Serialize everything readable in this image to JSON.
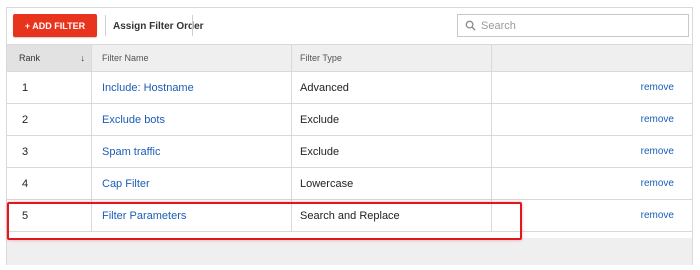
{
  "toolbar": {
    "add_filter_label": "+ ADD FILTER",
    "assign_order_label": "Assign Filter Order",
    "search_placeholder": "Search"
  },
  "table": {
    "columns": {
      "rank": "Rank",
      "sort_indicator": "↓",
      "name": "Filter Name",
      "type": "Filter Type"
    },
    "rows": [
      {
        "rank": "1",
        "name": "Include: Hostname",
        "type": "Advanced",
        "action": "remove"
      },
      {
        "rank": "2",
        "name": "Exclude bots",
        "type": "Exclude",
        "action": "remove"
      },
      {
        "rank": "3",
        "name": "Spam traffic",
        "type": "Exclude",
        "action": "remove"
      },
      {
        "rank": "4",
        "name": "Cap Filter",
        "type": "Lowercase",
        "action": "remove"
      },
      {
        "rank": "5",
        "name": "Filter Parameters",
        "type": "Search and Replace",
        "action": "remove"
      }
    ]
  },
  "colors": {
    "primary_button": "#e8341c",
    "link": "#1a5db5",
    "highlight_box": "#e0171f"
  },
  "icons": {
    "search": "search-icon",
    "sort": "sort-down-arrow-icon"
  }
}
